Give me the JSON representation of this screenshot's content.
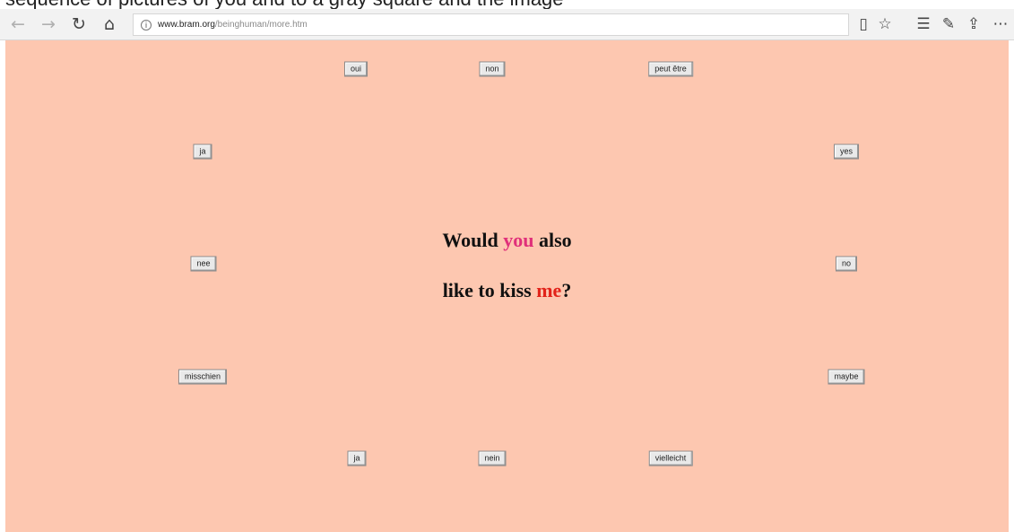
{
  "top_cut_text": "sequence of pictures of you and to a gray square and the image",
  "browser": {
    "url_domain": "www.bram.org",
    "url_path": "/beinghuman/more.htm"
  },
  "page": {
    "background": "#fdc7b0",
    "question": {
      "line1_prefix": "Would ",
      "line1_highlight": "you",
      "line1_suffix": " also",
      "line2_prefix": "like to kiss ",
      "line2_highlight": "me",
      "line2_suffix": "?",
      "highlight_you_color": "#e0307a",
      "highlight_me_color": "#e2231a"
    },
    "buttons": {
      "oui": "oui",
      "non": "non",
      "peut_etre": "peut être",
      "ja_left": "ja",
      "yes": "yes",
      "nee": "nee",
      "no": "no",
      "misschien": "misschien",
      "maybe": "maybe",
      "ja_bottom": "ja",
      "nein": "nein",
      "vielleicht": "vielleicht"
    }
  }
}
